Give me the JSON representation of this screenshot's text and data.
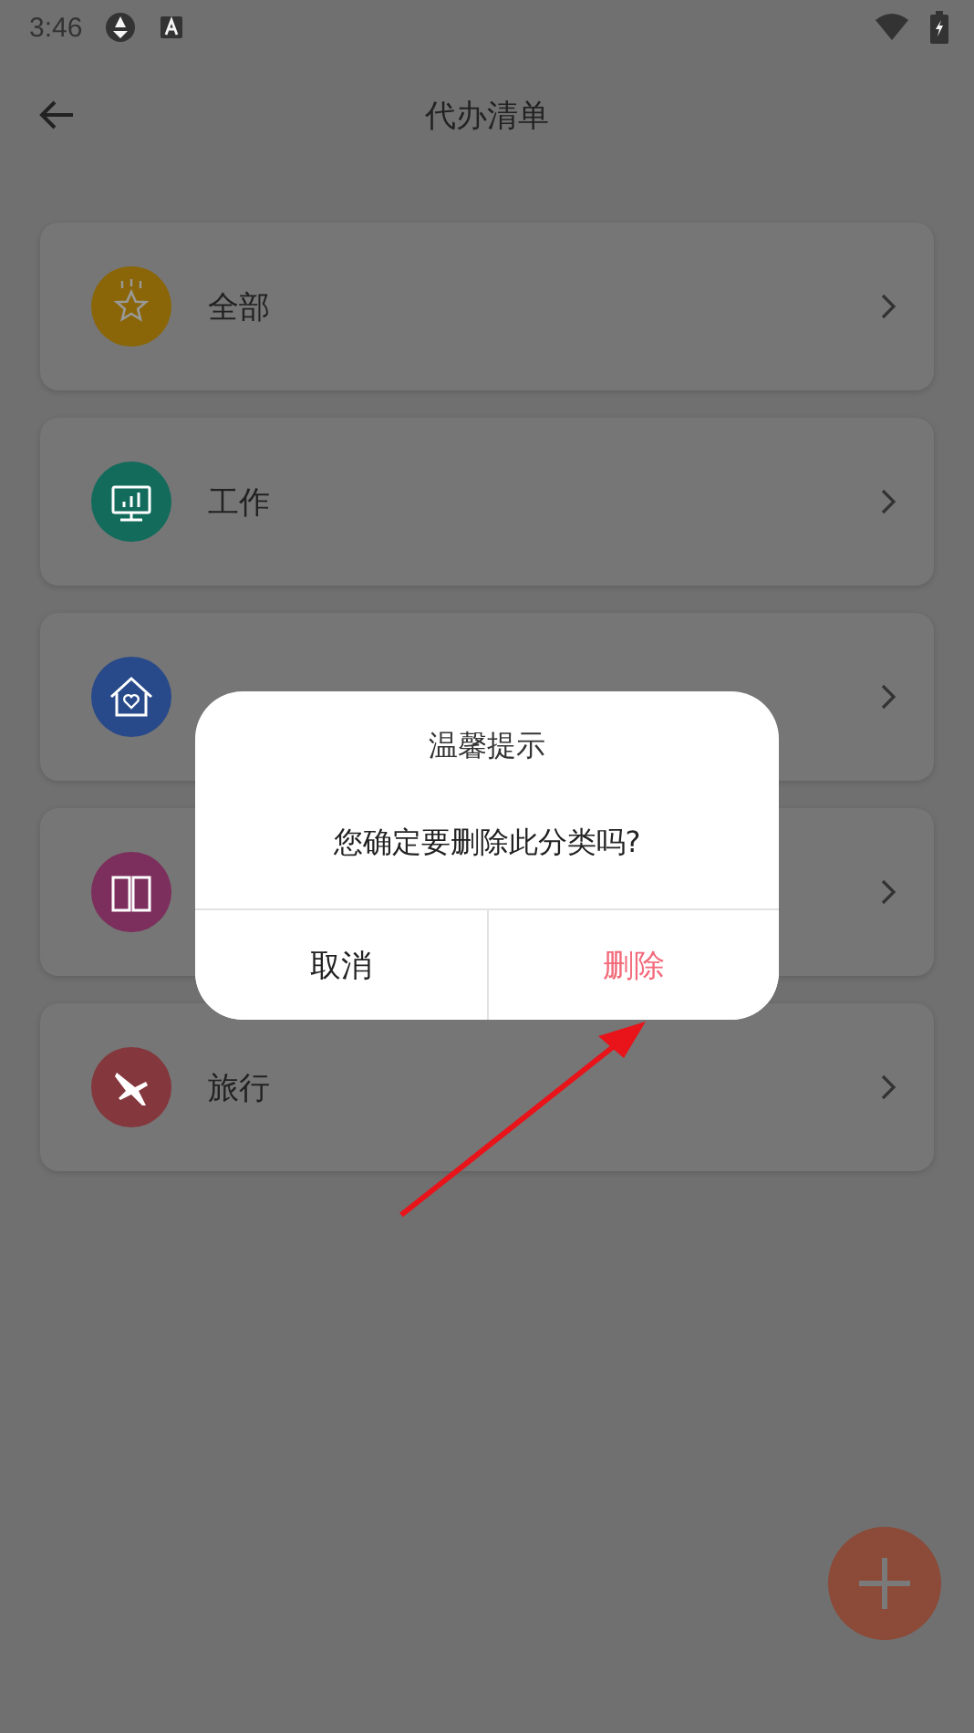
{
  "status_bar": {
    "time": "3:46"
  },
  "header": {
    "title": "代办清单"
  },
  "categories": [
    {
      "kind": "star",
      "label": "全部",
      "color": "#8a6608"
    },
    {
      "kind": "monitor",
      "label": "工作",
      "color": "#136b5c"
    },
    {
      "kind": "house",
      "color": "#284a8a"
    },
    {
      "kind": "book",
      "color": "#7c2f5c"
    },
    {
      "kind": "plane",
      "label": "旅行",
      "color": "#84373c"
    }
  ],
  "dialog": {
    "title": "温馨提示",
    "message": "您确定要删除此分类吗?",
    "buttons": [
      {
        "label": "取消",
        "kind": "cancel"
      },
      {
        "label": "删除",
        "kind": "danger"
      }
    ]
  }
}
